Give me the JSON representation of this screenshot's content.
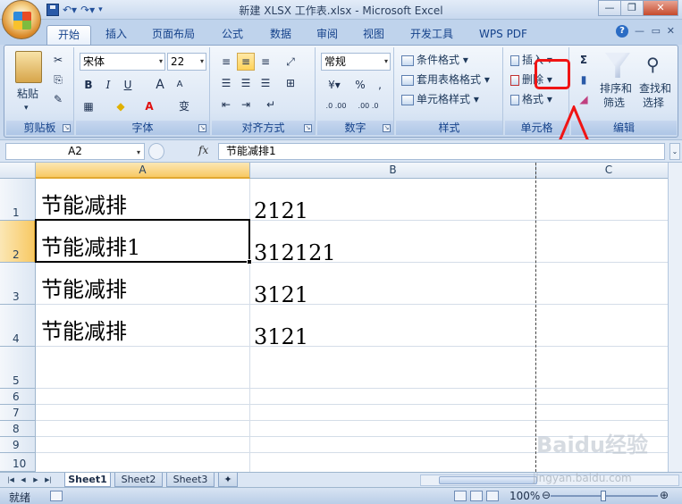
{
  "window": {
    "title": "新建 XLSX 工作表.xlsx - Microsoft Excel",
    "minimize": "—",
    "restore": "❐",
    "close": "✕"
  },
  "tabs": [
    "开始",
    "插入",
    "页面布局",
    "公式",
    "数据",
    "审阅",
    "视图",
    "开发工具",
    "WPS PDF"
  ],
  "ribbon": {
    "clipboard": {
      "label": "剪贴板",
      "paste": "粘贴"
    },
    "font": {
      "label": "字体",
      "name": "宋体",
      "size": "22",
      "bold": "B",
      "italic": "I",
      "underline": "U",
      "grow": "A",
      "shrink": "A",
      "wen": "变"
    },
    "alignment": {
      "label": "对齐方式"
    },
    "number": {
      "label": "数字",
      "format": "常规",
      "percent": "%",
      "comma": ",",
      "inc": ".0 .00",
      "dec": ".00 .0"
    },
    "styles": {
      "label": "样式",
      "conditional": "条件格式",
      "table": "套用表格格式",
      "cell": "单元格样式"
    },
    "cells": {
      "label": "单元格",
      "insert": "插入",
      "delete": "删除",
      "format": "格式"
    },
    "editing": {
      "label": "编辑",
      "sigma": "Σ",
      "sort": "排序和",
      "sort2": "筛选",
      "find": "查找和",
      "find2": "选择"
    }
  },
  "formula_bar": {
    "name_box": "A2",
    "fx": "fx",
    "content": "节能减排1"
  },
  "columns": [
    "A",
    "B",
    "C"
  ],
  "rows": [
    "1",
    "2",
    "3",
    "4",
    "5",
    "6",
    "7",
    "8",
    "9",
    "10"
  ],
  "cells": {
    "A1": "节能减排",
    "B1": "2121",
    "A2": "节能减排1",
    "B2": "312121",
    "A3": "节能减排",
    "B3": "3121",
    "A4": "节能减排",
    "B4": "3121"
  },
  "sheets": [
    "Sheet1",
    "Sheet2",
    "Sheet3"
  ],
  "status": {
    "ready": "就绪",
    "zoom": "100%"
  },
  "watermark": {
    "brand": "Baidu经验",
    "url": "jingyan.baidu.com"
  },
  "accent": {
    "annotation": "#f01414",
    "selection": "#f8c964"
  }
}
